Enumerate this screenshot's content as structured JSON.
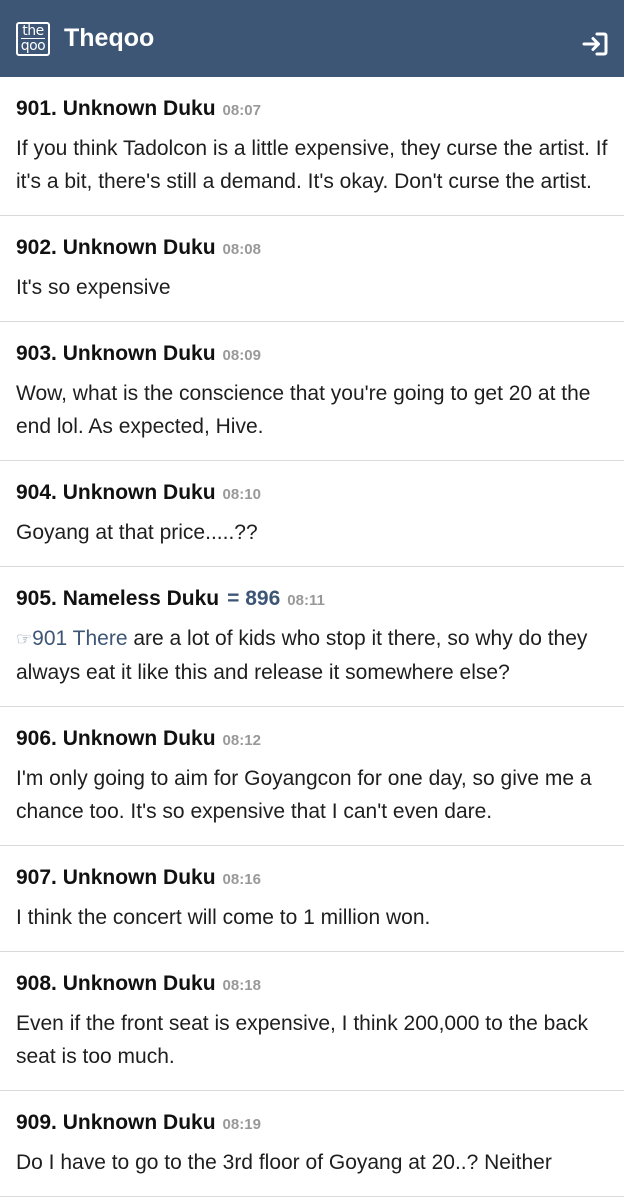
{
  "header": {
    "logo_top": "the",
    "logo_bottom": "qoo",
    "title": "Theqoo",
    "login_icon": "login-arrow-icon"
  },
  "comments": [
    {
      "num": "901.",
      "author": "Unknown Duku",
      "time": "08:07",
      "body": "If you think Tadolcon is a little expensive, they curse the artist. If it's a bit, there's still a demand. It's okay. Don't curse the artist."
    },
    {
      "num": "902.",
      "author": "Unknown Duku",
      "time": "08:08",
      "body": "It's so expensive"
    },
    {
      "num": "903.",
      "author": "Unknown Duku",
      "time": "08:09",
      "body": "Wow, what is the conscience that you're going to get 20 at the end lol. As expected, Hive."
    },
    {
      "num": "904.",
      "author": "Unknown Duku",
      "time": "08:10",
      "body": "Goyang at that price.....??"
    },
    {
      "num": "905.",
      "author": "Nameless Duku",
      "reply_ref": "= 896",
      "time": "08:11",
      "mention_hand": "☞",
      "mention": "901 There",
      "body": " are a lot of kids who stop it there, so why do they always eat it like this and release it somewhere else?"
    },
    {
      "num": "906.",
      "author": "Unknown Duku",
      "time": "08:12",
      "body": "I'm only going to aim for Goyangcon for one day, so give me a chance too. It's so expensive that I can't even dare."
    },
    {
      "num": "907.",
      "author": "Unknown Duku",
      "time": "08:16",
      "body": "I think the concert will come to 1 million won."
    },
    {
      "num": "908.",
      "author": "Unknown Duku",
      "time": "08:18",
      "body": "Even if the front seat is expensive, I think 200,000 to the back seat is too much."
    },
    {
      "num": "909.",
      "author": "Unknown Duku",
      "time": "08:19",
      "body": "Do I have to go to the 3rd floor of Goyang at 20..? Neither"
    }
  ]
}
